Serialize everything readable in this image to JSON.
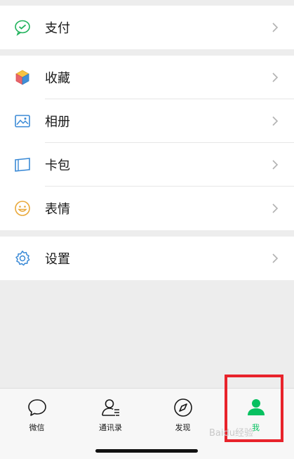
{
  "menu_groups": [
    [
      {
        "label": "支付",
        "icon": "wechat-pay-icon"
      }
    ],
    [
      {
        "label": "收藏",
        "icon": "favorites-cube-icon"
      },
      {
        "label": "相册",
        "icon": "album-icon"
      },
      {
        "label": "卡包",
        "icon": "card-wallet-icon"
      },
      {
        "label": "表情",
        "icon": "sticker-smile-icon"
      }
    ],
    [
      {
        "label": "设置",
        "icon": "settings-gear-icon"
      }
    ]
  ],
  "tabbar": {
    "tabs": [
      {
        "label": "微信",
        "icon": "chat-bubble-icon"
      },
      {
        "label": "通讯录",
        "icon": "contacts-icon"
      },
      {
        "label": "发现",
        "icon": "compass-icon"
      },
      {
        "label": "我",
        "icon": "me-person-icon"
      }
    ],
    "active_index": 3
  },
  "watermark": "Baidu经验",
  "colors": {
    "accent": "#07c160",
    "highlight_box": "#e8232b"
  }
}
